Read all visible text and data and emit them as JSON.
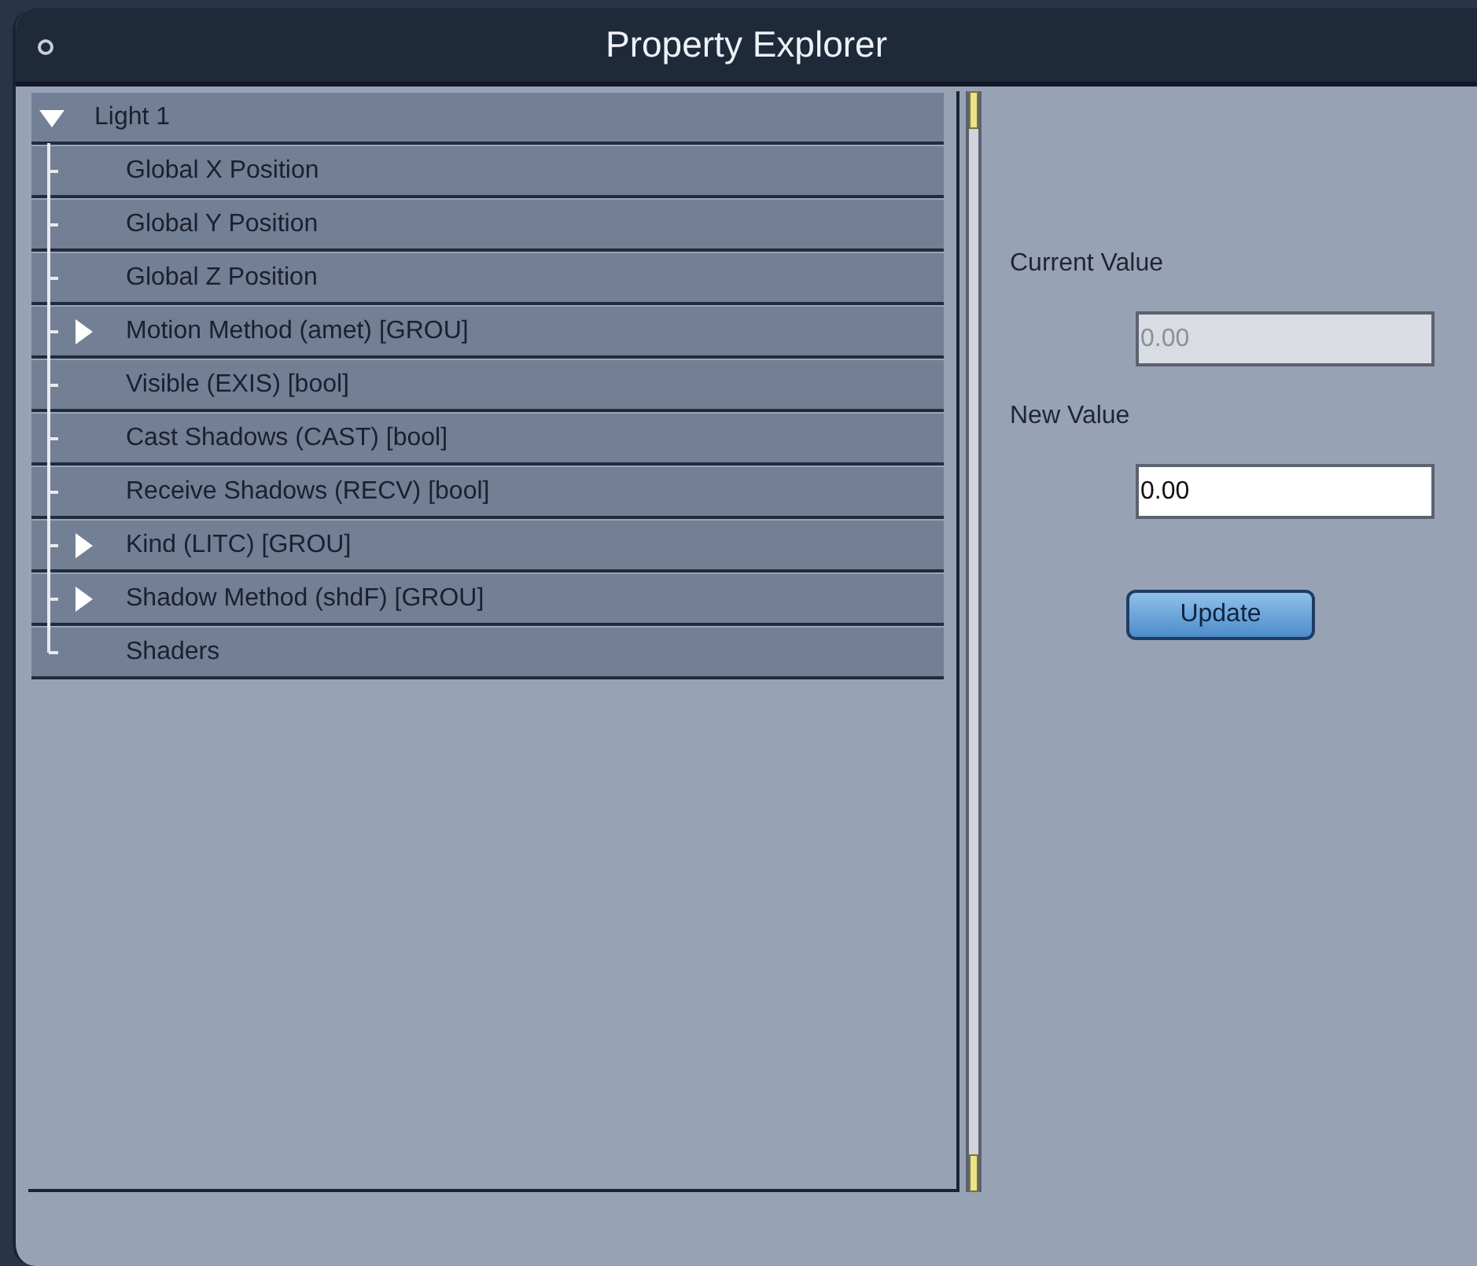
{
  "window": {
    "title": "Property Explorer"
  },
  "tree": [
    {
      "label": "Light 1",
      "kind": "group",
      "expanded": true,
      "children": [
        {
          "label": "Global X Position",
          "kind": "property"
        },
        {
          "label": "Global Y Position",
          "kind": "property"
        },
        {
          "label": "Global Z Position",
          "kind": "property"
        },
        {
          "label": "Motion Method (amet) [GROU]",
          "kind": "group",
          "expanded": false
        },
        {
          "label": "Visible (EXIS) [bool]",
          "kind": "property"
        },
        {
          "label": "Cast Shadows (CAST) [bool]",
          "kind": "property"
        },
        {
          "label": "Receive Shadows (RECV) [bool]",
          "kind": "property"
        },
        {
          "label": "Kind (LITC) [GROU]",
          "kind": "group",
          "expanded": false
        },
        {
          "label": "Shadow Method (shdF) [GROU]",
          "kind": "group",
          "expanded": false
        },
        {
          "label": "Shaders",
          "kind": "property"
        }
      ]
    }
  ],
  "editor": {
    "current_value": {
      "label": "Current Value",
      "value": "0.00",
      "disabled": true
    },
    "new_value": {
      "label": "New Value",
      "value": "0.00",
      "disabled": false
    },
    "button": "Update"
  }
}
